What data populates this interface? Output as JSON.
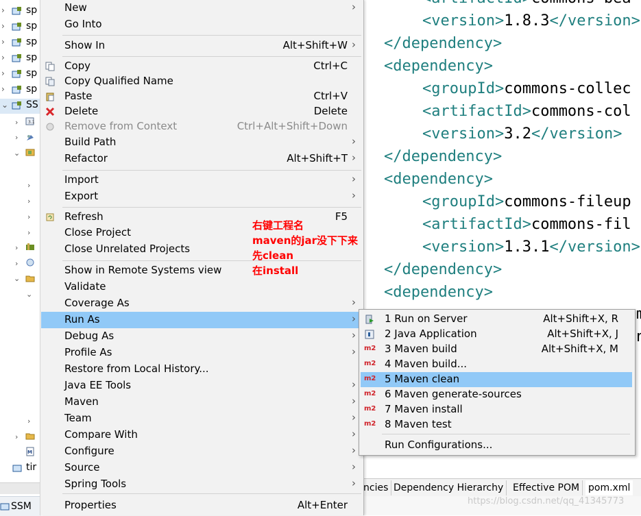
{
  "explorer": {
    "projects": [
      {
        "label": "sp"
      },
      {
        "label": "sp"
      },
      {
        "label": "sp"
      },
      {
        "label": "sp"
      },
      {
        "label": "sp"
      },
      {
        "label": "sp"
      },
      {
        "label": "SS"
      }
    ],
    "bottom_item": "tir",
    "status_project": "SSM"
  },
  "editor": {
    "lines": [
      {
        "indent": 2,
        "open": "artifactId",
        "text": "commons-bea"
      },
      {
        "indent": 2,
        "open": "version",
        "text": "1.8.3",
        "close": "version"
      },
      {
        "indent": 1,
        "close_only": "dependency"
      },
      {
        "indent": 1,
        "open_only": "dependency"
      },
      {
        "indent": 2,
        "open": "groupId",
        "text": "commons-collec"
      },
      {
        "indent": 2,
        "open": "artifactId",
        "text": "commons-col"
      },
      {
        "indent": 2,
        "open": "version",
        "text": "3.2",
        "close": "version"
      },
      {
        "indent": 1,
        "close_only": "dependency"
      },
      {
        "indent": 1,
        "open_only": "dependency"
      },
      {
        "indent": 2,
        "open": "groupId",
        "text": "commons-fileup"
      },
      {
        "indent": 2,
        "open": "artifactId",
        "text": "commons-fil"
      },
      {
        "indent": 2,
        "open": "version",
        "text": "1.3.1",
        "close": "version"
      },
      {
        "indent": 1,
        "close_only": "dependency"
      },
      {
        "indent": 1,
        "open_only": "dependency"
      }
    ],
    "tabs": [
      "ncies",
      "Dependency Hierarchy",
      "Effective POM",
      "pom.xml"
    ],
    "watermark": "https://blog.csdn.net/qq_41345773"
  },
  "context_menu": {
    "items": [
      {
        "label": "New",
        "submenu": true
      },
      {
        "label": "Go Into"
      },
      {
        "sep": true
      },
      {
        "label": "Show In",
        "shortcut": "Alt+Shift+W",
        "submenu": true
      },
      {
        "sep": true
      },
      {
        "label": "Copy",
        "shortcut": "Ctrl+C",
        "icon": "copy-icon"
      },
      {
        "label": "Copy Qualified Name",
        "icon": "copy-qualified-icon"
      },
      {
        "label": "Paste",
        "shortcut": "Ctrl+V",
        "icon": "paste-icon"
      },
      {
        "label": "Delete",
        "shortcut": "Delete",
        "icon": "delete-icon"
      },
      {
        "label": "Remove from Context",
        "shortcut": "Ctrl+Alt+Shift+Down",
        "disabled": true,
        "icon": "remove-context-icon"
      },
      {
        "label": "Build Path",
        "submenu": true
      },
      {
        "label": "Refactor",
        "shortcut": "Alt+Shift+T",
        "submenu": true
      },
      {
        "sep": true
      },
      {
        "label": "Import",
        "submenu": true
      },
      {
        "label": "Export",
        "submenu": true
      },
      {
        "sep": true
      },
      {
        "label": "Refresh",
        "shortcut": "F5",
        "icon": "refresh-icon"
      },
      {
        "label": "Close Project"
      },
      {
        "label": "Close Unrelated Projects"
      },
      {
        "sep": true
      },
      {
        "label": "Show in Remote Systems view"
      },
      {
        "label": "Validate"
      },
      {
        "label": "Coverage As",
        "submenu": true
      },
      {
        "label": "Run As",
        "submenu": true,
        "highlight": true
      },
      {
        "label": "Debug As",
        "submenu": true
      },
      {
        "label": "Profile As",
        "submenu": true
      },
      {
        "label": "Restore from Local History..."
      },
      {
        "label": "Java EE Tools",
        "submenu": true
      },
      {
        "label": "Maven",
        "submenu": true
      },
      {
        "label": "Team",
        "submenu": true
      },
      {
        "label": "Compare With",
        "submenu": true
      },
      {
        "label": "Configure",
        "submenu": true
      },
      {
        "label": "Source",
        "submenu": true
      },
      {
        "label": "Spring Tools",
        "submenu": true
      },
      {
        "sep": true
      },
      {
        "label": "Properties",
        "shortcut": "Alt+Enter"
      }
    ]
  },
  "annotation": {
    "lines": [
      "右键工程名",
      "maven的jar没下下来",
      "先clean",
      "在install"
    ],
    "color": "#ff0000"
  },
  "run_as_submenu": {
    "items": [
      {
        "label": "1 Run on Server",
        "shortcut": "Alt+Shift+X, R",
        "icon": "run-server-icon"
      },
      {
        "label": "2 Java Application",
        "shortcut": "Alt+Shift+X, J",
        "icon": "java-app-icon"
      },
      {
        "label": "3 Maven build",
        "shortcut": "Alt+Shift+X, M",
        "icon": "m2-icon",
        "icon_text": "m2"
      },
      {
        "label": "4 Maven build...",
        "icon": "m2-icon",
        "icon_text": "m2"
      },
      {
        "label": "5 Maven clean",
        "icon": "m2-icon",
        "icon_text": "m2",
        "highlight": true
      },
      {
        "label": "6 Maven generate-sources",
        "icon": "m2-icon",
        "icon_text": "m2"
      },
      {
        "label": "7 Maven install",
        "icon": "m2-icon",
        "icon_text": "m2"
      },
      {
        "label": "8 Maven test",
        "icon": "m2-icon",
        "icon_text": "m2"
      },
      {
        "sep": true
      },
      {
        "label": "Run Configurations..."
      }
    ]
  },
  "colors": {
    "highlight": "#91c9f7",
    "xml_tag": "#1f7f7f",
    "m2_red": "#d0232a"
  }
}
